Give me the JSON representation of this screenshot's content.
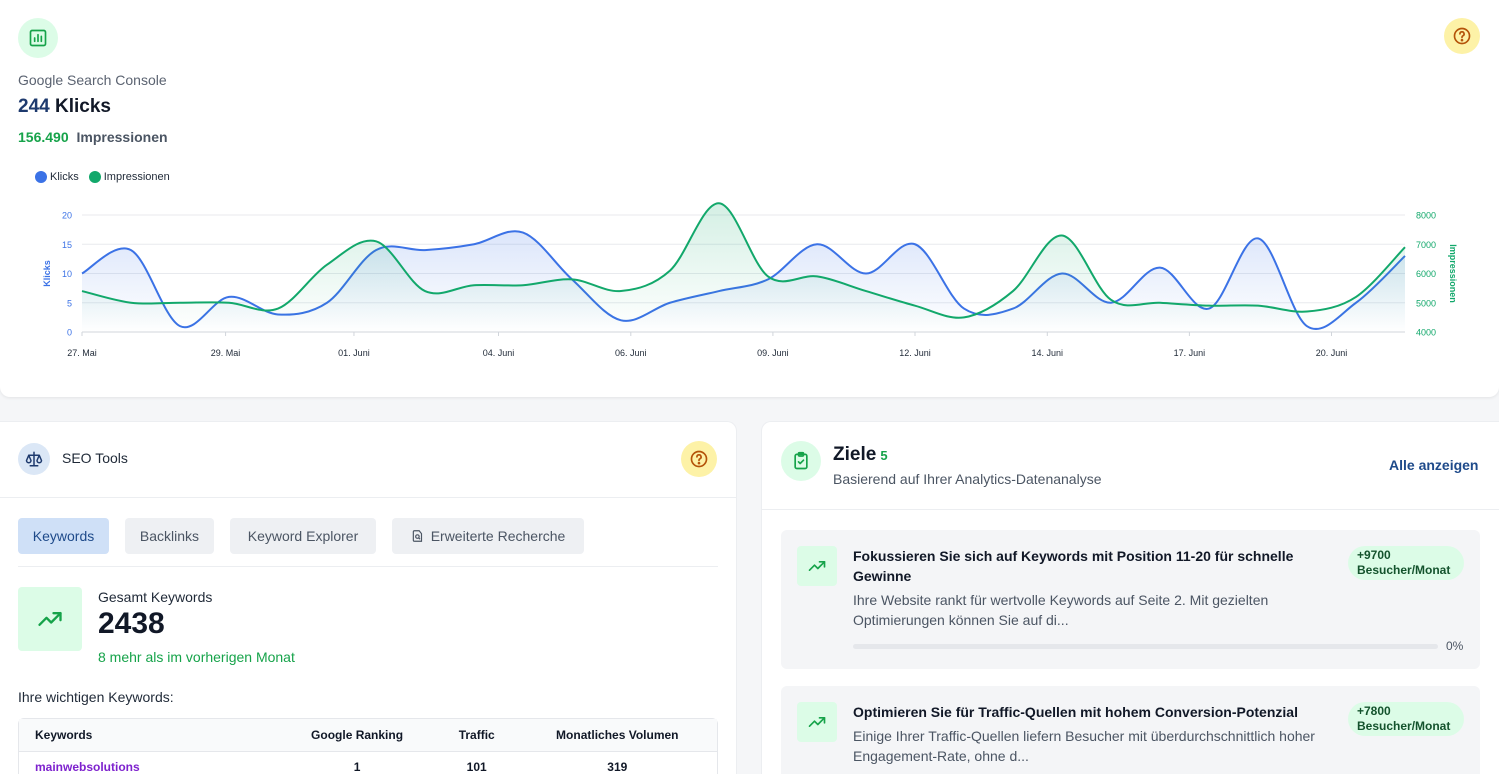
{
  "gsc": {
    "label": "Google Search Console",
    "clicks_value": "244",
    "clicks_label": "Klicks",
    "impressions_value": "156.490",
    "impressions_label": "Impressionen",
    "icon": "bar-chart-icon",
    "help_icon": "question-icon"
  },
  "chart_data": {
    "type": "line",
    "x_tick_labels": [
      "27. Mai",
      "29. Mai",
      "01. Juni",
      "04. Juni",
      "06. Juni",
      "09. Juni",
      "12. Juni",
      "14. Juni",
      "17. Juni",
      "20. Juni"
    ],
    "series": [
      {
        "name": "Klicks",
        "axis": "left",
        "color": "#3b72e6",
        "values": [
          10,
          14,
          1,
          6,
          3,
          5,
          14,
          14,
          15,
          17,
          9,
          2,
          5,
          7,
          9,
          15,
          10,
          15,
          4,
          4,
          10,
          5,
          11,
          4,
          16,
          1,
          5,
          13
        ]
      },
      {
        "name": "Impressionen",
        "axis": "right",
        "color": "#12a86b",
        "values": [
          5400,
          5000,
          5000,
          5000,
          4800,
          6300,
          7100,
          5400,
          5600,
          5600,
          5800,
          5400,
          6100,
          8400,
          5900,
          5900,
          5400,
          4900,
          4500,
          5400,
          7300,
          5100,
          5000,
          4900,
          4900,
          4700,
          5200,
          6900
        ]
      }
    ],
    "y_left": {
      "label": "Klicks",
      "min": 0,
      "max": 20,
      "ticks": [
        0,
        5,
        10,
        15,
        20
      ]
    },
    "y_right": {
      "label": "Impressionen",
      "min": 4000,
      "max": 8000,
      "ticks": [
        4000,
        5000,
        6000,
        7000,
        8000
      ]
    },
    "grid": true,
    "legend": "top-left"
  },
  "seo": {
    "title": "SEO Tools",
    "tabs": [
      "Keywords",
      "Backlinks",
      "Keyword Explorer",
      "Erweiterte Recherche"
    ],
    "active_tab": "Keywords",
    "kpi_label": "Gesamt Keywords",
    "kpi_value": "2438",
    "kpi_sub": "8 mehr als im vorherigen Monat",
    "keywords_heading": "Ihre wichtigen Keywords:",
    "table": {
      "columns": [
        "Keywords",
        "Google Ranking",
        "Traffic",
        "Monatliches Volumen"
      ],
      "rows": [
        [
          "mainwebsolutions",
          "1",
          "101",
          "319"
        ]
      ]
    }
  },
  "goals": {
    "title": "Ziele",
    "count": "5",
    "subtitle": "Basierend auf Ihrer Analytics-Datenanalyse",
    "all_link": "Alle anzeigen",
    "items": [
      {
        "title": "Fokussieren Sie sich auf Keywords mit Position 11-20 für schnelle Gewinne",
        "description": "Ihre Website rankt für wertvolle Keywords auf Seite 2. Mit gezielten Optimierungen können Sie auf di...",
        "badge_value": "+9700",
        "badge_unit": "Besucher/Monat",
        "progress_label": "0%",
        "progress": 0
      },
      {
        "title": "Optimieren Sie für Traffic-Quellen mit hohem Conversion-Potenzial",
        "description": "Einige Ihrer Traffic-Quellen liefern Besucher mit überdurchschnittlich hoher Engagement-Rate, ohne d...",
        "badge_value": "+7800",
        "badge_unit": "Besucher/Monat"
      }
    ]
  }
}
